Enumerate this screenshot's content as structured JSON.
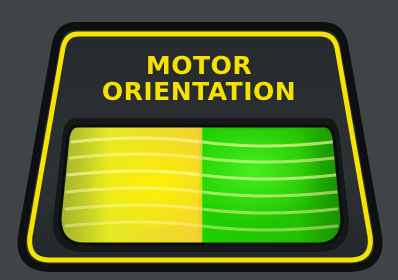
{
  "panel": {
    "title_line1": "MOTOR",
    "title_line2": "ORIENTATION"
  },
  "indicator": {
    "left_state_color": "#f3f000",
    "right_state_color": "#22d400",
    "border_color": "#f4e400"
  }
}
